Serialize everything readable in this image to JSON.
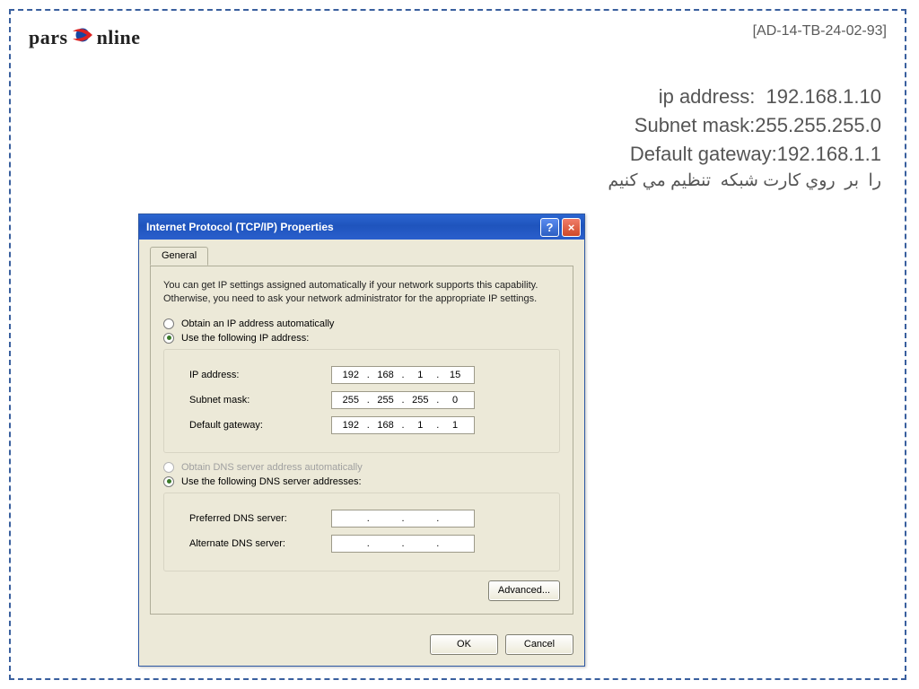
{
  "header": {
    "logo_left": "pars",
    "logo_right": "nline",
    "doc_ref": "[AD-14-TB-24-02-93]"
  },
  "info": {
    "ip_line": "ip address:  192.168.1.10",
    "subnet_line": "Subnet mask:255.255.255.0",
    "gateway_line": "Default gateway:192.168.1.1",
    "farsi_line": "را  بر  روي کارت شبکه  تنظيم مي کنيم"
  },
  "dialog": {
    "title": "Internet Protocol (TCP/IP) Properties",
    "help_glyph": "?",
    "close_glyph": "×",
    "tab": "General",
    "description": "You can get IP settings assigned automatically if your network supports this capability. Otherwise, you need to ask your network administrator for the appropriate IP settings.",
    "radio_auto_ip": "Obtain an IP address automatically",
    "radio_static_ip": "Use the following IP address:",
    "ip_label": "IP address:",
    "ip_value": {
      "a": "192",
      "b": "168",
      "c": "1",
      "d": "15"
    },
    "subnet_label": "Subnet mask:",
    "subnet_value": {
      "a": "255",
      "b": "255",
      "c": "255",
      "d": "0"
    },
    "gateway_label": "Default gateway:",
    "gateway_value": {
      "a": "192",
      "b": "168",
      "c": "1",
      "d": "1"
    },
    "radio_auto_dns": "Obtain DNS server address automatically",
    "radio_static_dns": "Use the following DNS server addresses:",
    "preferred_dns_label": "Preferred DNS server:",
    "alternate_dns_label": "Alternate DNS server:",
    "advanced_btn": "Advanced...",
    "ok_btn": "OK",
    "cancel_btn": "Cancel"
  }
}
